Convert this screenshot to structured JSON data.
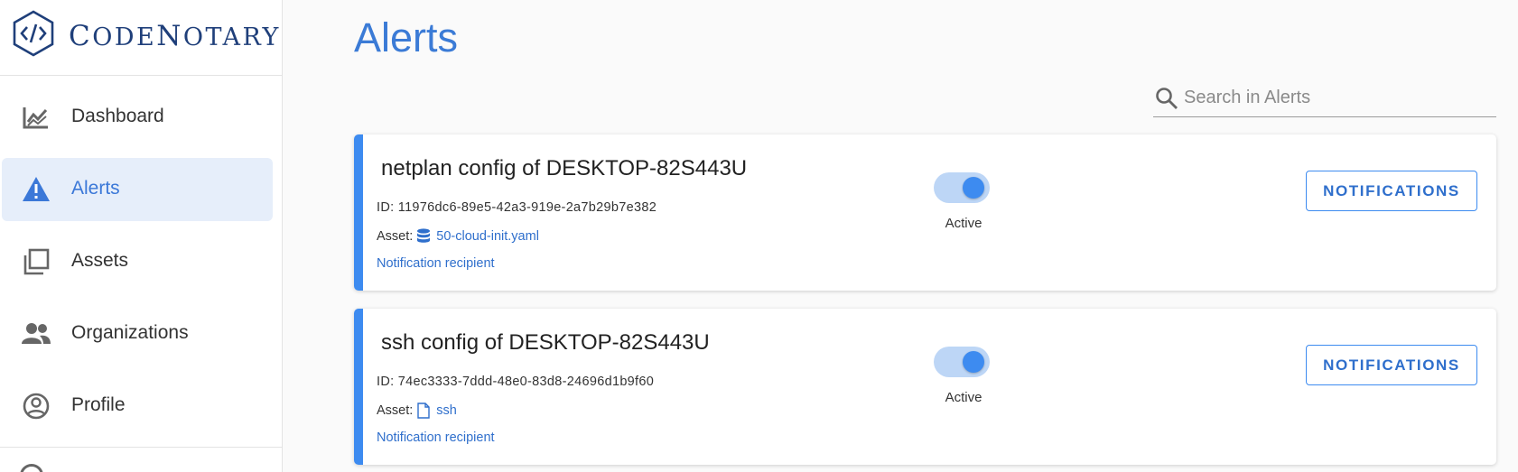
{
  "brand": {
    "name_first": "C",
    "name_rest_1": "ODE",
    "name_mid": "N",
    "name_rest_2": "OTARY",
    "colors": {
      "accent": "#3b7bd6",
      "logo": "#1f3f7a"
    }
  },
  "sidebar": {
    "items": [
      {
        "label": "Dashboard",
        "icon": "chart-line-icon"
      },
      {
        "label": "Alerts",
        "icon": "alert-triangle-icon",
        "active": true
      },
      {
        "label": "Assets",
        "icon": "copy-icon"
      },
      {
        "label": "Organizations",
        "icon": "users-icon"
      },
      {
        "label": "Profile",
        "icon": "account-circle-icon"
      }
    ]
  },
  "main": {
    "title": "Alerts",
    "search": {
      "placeholder": "Search in Alerts",
      "value": ""
    },
    "alerts": [
      {
        "title": "netplan config of DESKTOP-82S443U",
        "id_label": "ID:",
        "id": "11976dc6-89e5-42a3-919e-2a7b29b7e382",
        "asset_label": "Asset:",
        "asset_name": "50-cloud-init.yaml",
        "asset_icon": "database-icon",
        "recipient_link": "Notification recipient",
        "status": "Active",
        "enabled": true,
        "button": "NOTIFICATIONS"
      },
      {
        "title": "ssh config of DESKTOP-82S443U",
        "id_label": "ID:",
        "id": "74ec3333-7ddd-48e0-83d8-24696d1b9f60",
        "asset_label": "Asset:",
        "asset_name": "ssh",
        "asset_icon": "file-icon",
        "recipient_link": "Notification recipient",
        "status": "Active",
        "enabled": true,
        "button": "NOTIFICATIONS"
      }
    ]
  }
}
